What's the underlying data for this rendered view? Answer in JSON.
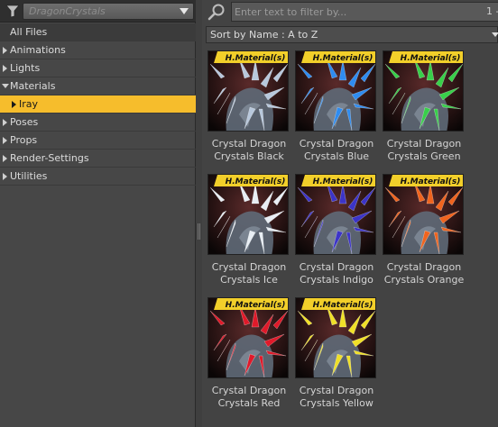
{
  "category_bar": {
    "selector_text": "DragonCrystals",
    "filter_icon": "funnel-icon",
    "dropdown_icon": "chevron-down-icon"
  },
  "tree": {
    "all_files": "All Files",
    "items": [
      {
        "label": "Animations",
        "expanded": false
      },
      {
        "label": "Lights",
        "expanded": false
      },
      {
        "label": "Materials",
        "expanded": true
      },
      {
        "label": "Iray",
        "selected": true
      },
      {
        "label": "Poses",
        "expanded": false
      },
      {
        "label": "Props",
        "expanded": false
      },
      {
        "label": "Render-Settings",
        "expanded": false
      },
      {
        "label": "Utilities",
        "expanded": false
      }
    ]
  },
  "search": {
    "placeholder": "Enter text to filter by...",
    "icon": "magnifier-icon",
    "page_indicator": "1 -"
  },
  "sort": {
    "label": "Sort by Name : A to Z"
  },
  "badge_text": "H.Material(s)",
  "colors": {
    "selected_row": "#f6bd2c",
    "badge": "#f2cf2a"
  },
  "products": [
    {
      "line1": "Crystal Dragon",
      "line2": "Crystals Black",
      "crystal": "#b8c8dc"
    },
    {
      "line1": "Crystal Dragon",
      "line2": "Crystals Blue",
      "crystal": "#2f8cf0"
    },
    {
      "line1": "Crystal Dragon",
      "line2": "Crystals Green",
      "crystal": "#38d04a"
    },
    {
      "line1": "Crystal Dragon",
      "line2": "Crystals Ice",
      "crystal": "#e8eef4"
    },
    {
      "line1": "Crystal Dragon",
      "line2": "Crystals Indigo",
      "crystal": "#3c34c8"
    },
    {
      "line1": "Crystal Dragon",
      "line2": "Crystals Orange",
      "crystal": "#f0641e"
    },
    {
      "line1": "Crystal Dragon",
      "line2": "Crystals Red",
      "crystal": "#e01a2a"
    },
    {
      "line1": "Crystal Dragon",
      "line2": "Crystals Yellow",
      "crystal": "#f0e028"
    }
  ]
}
